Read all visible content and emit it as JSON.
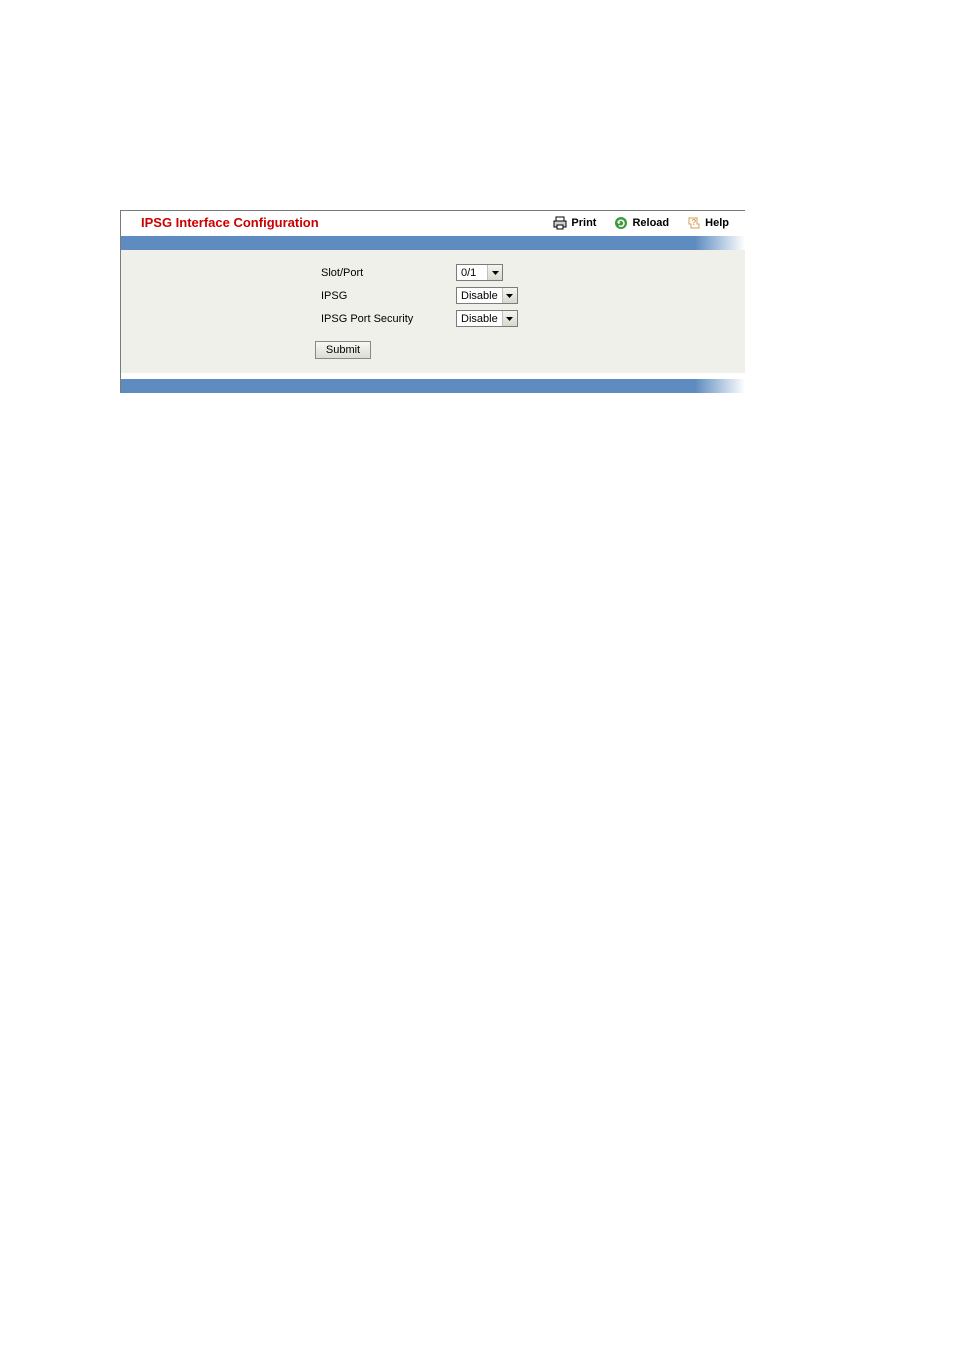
{
  "header": {
    "title": "IPSG Interface Configuration"
  },
  "actions": {
    "print": "Print",
    "reload": "Reload",
    "help": "Help"
  },
  "form": {
    "slot_port": {
      "label": "Slot/Port",
      "value": "0/1"
    },
    "ipsg": {
      "label": "IPSG",
      "value": "Disable"
    },
    "ipsg_port_security": {
      "label": "IPSG Port Security",
      "value": "Disable"
    },
    "submit_label": "Submit"
  }
}
